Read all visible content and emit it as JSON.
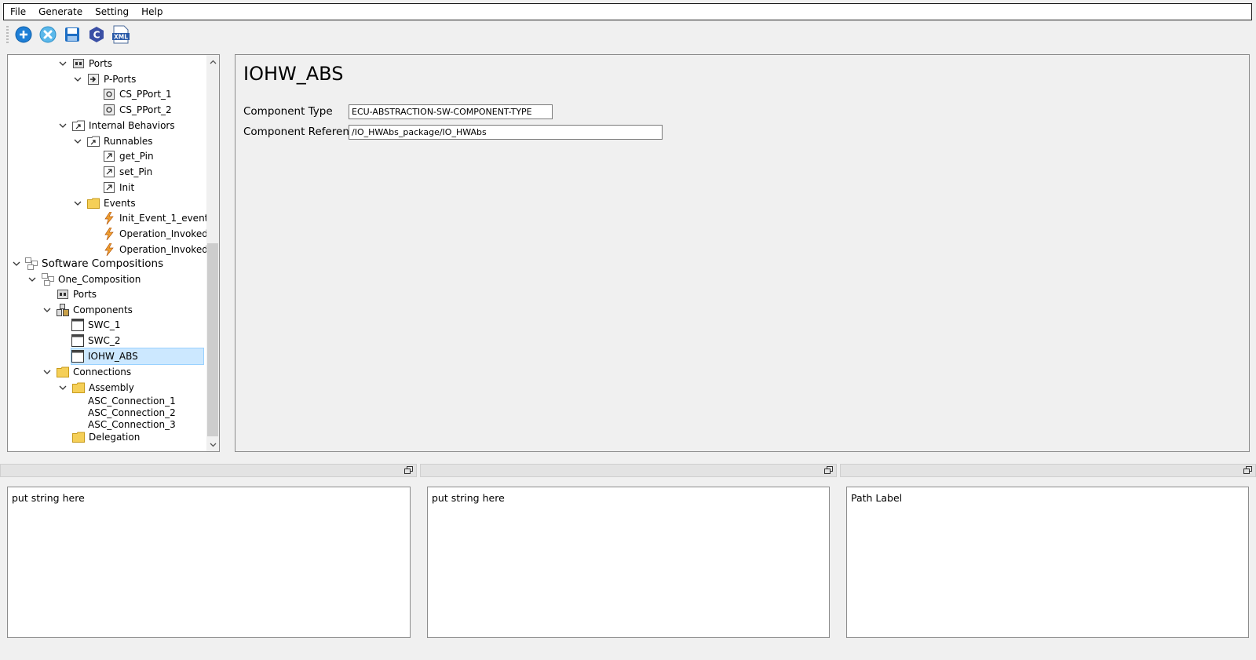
{
  "menu": [
    "File",
    "Generate",
    "Setting",
    "Help"
  ],
  "toolbar": {
    "icons": [
      "add-icon",
      "close-icon",
      "save-icon",
      "c-code-icon",
      "xml-icon"
    ],
    "xml_text": "XML",
    "c_text": "C"
  },
  "tree": {
    "items": [
      {
        "label": "Ports",
        "icon": "ports-icon"
      },
      {
        "label": "P-Ports",
        "icon": "pport-folder-icon"
      },
      {
        "label": "CS_PPort_1",
        "icon": "port-icon"
      },
      {
        "label": "CS_PPort_2",
        "icon": "port-icon"
      },
      {
        "label": "Internal Behaviors",
        "icon": "behavior-folder-icon"
      },
      {
        "label": "Runnables",
        "icon": "runnables-folder-icon"
      },
      {
        "label": "get_Pin",
        "icon": "runnable-icon"
      },
      {
        "label": "set_Pin",
        "icon": "runnable-icon"
      },
      {
        "label": "Init",
        "icon": "runnable-icon"
      },
      {
        "label": "Events",
        "icon": "folder-icon"
      },
      {
        "label": "Init_Event_1_event",
        "icon": "event-icon"
      },
      {
        "label": "Operation_Invoked...",
        "icon": "event-icon"
      },
      {
        "label": "Operation_Invoked...",
        "icon": "event-icon"
      },
      {
        "label": "Software Compositions",
        "icon": "composition-icon"
      },
      {
        "label": "One_Composition",
        "icon": "composition-icon"
      },
      {
        "label": "Ports",
        "icon": "ports-icon"
      },
      {
        "label": "Components",
        "icon": "components-icon"
      },
      {
        "label": "SWC_1",
        "icon": "component-icon"
      },
      {
        "label": "SWC_2",
        "icon": "component-icon"
      },
      {
        "label": "IOHW_ABS",
        "icon": "component-icon"
      },
      {
        "label": "Connections",
        "icon": "folder-icon"
      },
      {
        "label": "Assembly",
        "icon": "folder-icon"
      },
      {
        "label": "ASC_Connection_1",
        "icon": ""
      },
      {
        "label": "ASC_Connection_2",
        "icon": ""
      },
      {
        "label": "ASC_Connection_3",
        "icon": ""
      },
      {
        "label": "Delegation",
        "icon": "folder-icon"
      }
    ]
  },
  "detail": {
    "title": "IOHW_ABS",
    "component_type_label": "Component Type",
    "component_type_value": "ECU-ABSTRACTION-SW-COMPONENT-TYPE",
    "component_reference_label": "Component Reference",
    "component_reference_value": "/IO_HWAbs_package/IO_HWAbs"
  },
  "panels": [
    {
      "text": "put string here"
    },
    {
      "text": "put string here"
    },
    {
      "text": "Path Label"
    }
  ],
  "colors": {
    "selection": "#cce8ff",
    "event_bolt": "#f0a030",
    "folder": "#f5cf57",
    "toolbar_blue": "#1f7fd6"
  }
}
